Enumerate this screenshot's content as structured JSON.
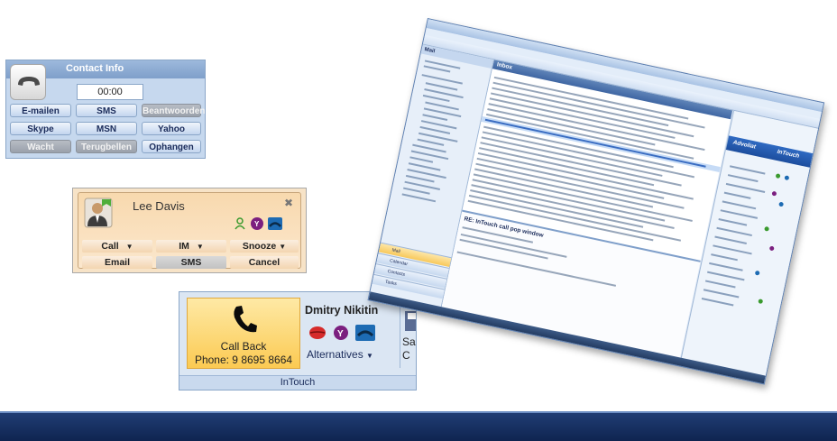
{
  "contact_info": {
    "title": "Contact Info",
    "timer": "00:00",
    "buttons": [
      {
        "label": "E-mailen",
        "enabled": true
      },
      {
        "label": "SMS",
        "enabled": true
      },
      {
        "label": "Beantwoorden",
        "enabled": false
      },
      {
        "label": "Skype",
        "enabled": true
      },
      {
        "label": "MSN",
        "enabled": true
      },
      {
        "label": "Yahoo",
        "enabled": true
      },
      {
        "label": "Wacht",
        "enabled": false
      },
      {
        "label": "Terugbellen",
        "enabled": false
      },
      {
        "label": "Ophangen",
        "enabled": true
      }
    ]
  },
  "popup": {
    "name": "Lee Davis",
    "buttons": [
      {
        "label": "Call",
        "dropdown": true
      },
      {
        "label": "IM",
        "dropdown": true
      },
      {
        "label": "Snooze",
        "dropdown": true
      },
      {
        "label": "Email",
        "dropdown": false
      },
      {
        "label": "SMS",
        "dropdown": false
      },
      {
        "label": "Cancel",
        "dropdown": false
      }
    ]
  },
  "ribbon": {
    "call_back_label": "Call Back",
    "phone": "Phone: 9 8695 8664",
    "contact_name": "Dmitry Nikitin",
    "alternatives_label": "Alternatives",
    "group_label": "InTouch",
    "clipped_label_1": "Sa",
    "clipped_label_2": "C"
  },
  "outlook": {
    "section": "Mail",
    "folder": "Inbox",
    "preview_title": "RE: InTouch call pop window",
    "nav_buttons": [
      "Mail",
      "Calendar",
      "Contacts",
      "Tasks"
    ],
    "brand_left": "Advoliat",
    "brand_right": "InTouch"
  },
  "colors": {
    "panel_blue": "#c6d8ee",
    "popup_orange": "#f8d9ae",
    "callback_yellow": "#fbca52",
    "band_navy": "#0f2450"
  }
}
